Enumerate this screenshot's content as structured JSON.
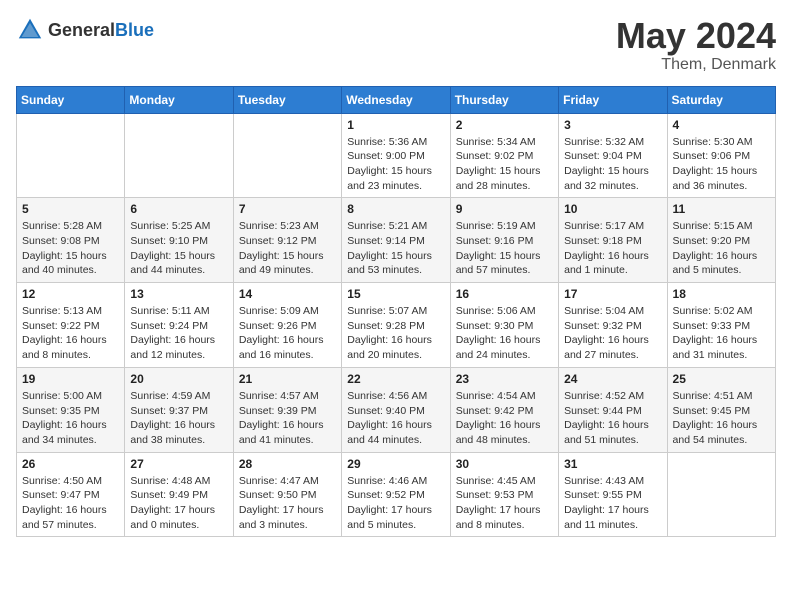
{
  "header": {
    "logo_general": "General",
    "logo_blue": "Blue",
    "month": "May 2024",
    "location": "Them, Denmark"
  },
  "weekdays": [
    "Sunday",
    "Monday",
    "Tuesday",
    "Wednesday",
    "Thursday",
    "Friday",
    "Saturday"
  ],
  "weeks": [
    [
      {
        "day": "",
        "info": ""
      },
      {
        "day": "",
        "info": ""
      },
      {
        "day": "",
        "info": ""
      },
      {
        "day": "1",
        "info": "Sunrise: 5:36 AM\nSunset: 9:00 PM\nDaylight: 15 hours\nand 23 minutes."
      },
      {
        "day": "2",
        "info": "Sunrise: 5:34 AM\nSunset: 9:02 PM\nDaylight: 15 hours\nand 28 minutes."
      },
      {
        "day": "3",
        "info": "Sunrise: 5:32 AM\nSunset: 9:04 PM\nDaylight: 15 hours\nand 32 minutes."
      },
      {
        "day": "4",
        "info": "Sunrise: 5:30 AM\nSunset: 9:06 PM\nDaylight: 15 hours\nand 36 minutes."
      }
    ],
    [
      {
        "day": "5",
        "info": "Sunrise: 5:28 AM\nSunset: 9:08 PM\nDaylight: 15 hours\nand 40 minutes."
      },
      {
        "day": "6",
        "info": "Sunrise: 5:25 AM\nSunset: 9:10 PM\nDaylight: 15 hours\nand 44 minutes."
      },
      {
        "day": "7",
        "info": "Sunrise: 5:23 AM\nSunset: 9:12 PM\nDaylight: 15 hours\nand 49 minutes."
      },
      {
        "day": "8",
        "info": "Sunrise: 5:21 AM\nSunset: 9:14 PM\nDaylight: 15 hours\nand 53 minutes."
      },
      {
        "day": "9",
        "info": "Sunrise: 5:19 AM\nSunset: 9:16 PM\nDaylight: 15 hours\nand 57 minutes."
      },
      {
        "day": "10",
        "info": "Sunrise: 5:17 AM\nSunset: 9:18 PM\nDaylight: 16 hours\nand 1 minute."
      },
      {
        "day": "11",
        "info": "Sunrise: 5:15 AM\nSunset: 9:20 PM\nDaylight: 16 hours\nand 5 minutes."
      }
    ],
    [
      {
        "day": "12",
        "info": "Sunrise: 5:13 AM\nSunset: 9:22 PM\nDaylight: 16 hours\nand 8 minutes."
      },
      {
        "day": "13",
        "info": "Sunrise: 5:11 AM\nSunset: 9:24 PM\nDaylight: 16 hours\nand 12 minutes."
      },
      {
        "day": "14",
        "info": "Sunrise: 5:09 AM\nSunset: 9:26 PM\nDaylight: 16 hours\nand 16 minutes."
      },
      {
        "day": "15",
        "info": "Sunrise: 5:07 AM\nSunset: 9:28 PM\nDaylight: 16 hours\nand 20 minutes."
      },
      {
        "day": "16",
        "info": "Sunrise: 5:06 AM\nSunset: 9:30 PM\nDaylight: 16 hours\nand 24 minutes."
      },
      {
        "day": "17",
        "info": "Sunrise: 5:04 AM\nSunset: 9:32 PM\nDaylight: 16 hours\nand 27 minutes."
      },
      {
        "day": "18",
        "info": "Sunrise: 5:02 AM\nSunset: 9:33 PM\nDaylight: 16 hours\nand 31 minutes."
      }
    ],
    [
      {
        "day": "19",
        "info": "Sunrise: 5:00 AM\nSunset: 9:35 PM\nDaylight: 16 hours\nand 34 minutes."
      },
      {
        "day": "20",
        "info": "Sunrise: 4:59 AM\nSunset: 9:37 PM\nDaylight: 16 hours\nand 38 minutes."
      },
      {
        "day": "21",
        "info": "Sunrise: 4:57 AM\nSunset: 9:39 PM\nDaylight: 16 hours\nand 41 minutes."
      },
      {
        "day": "22",
        "info": "Sunrise: 4:56 AM\nSunset: 9:40 PM\nDaylight: 16 hours\nand 44 minutes."
      },
      {
        "day": "23",
        "info": "Sunrise: 4:54 AM\nSunset: 9:42 PM\nDaylight: 16 hours\nand 48 minutes."
      },
      {
        "day": "24",
        "info": "Sunrise: 4:52 AM\nSunset: 9:44 PM\nDaylight: 16 hours\nand 51 minutes."
      },
      {
        "day": "25",
        "info": "Sunrise: 4:51 AM\nSunset: 9:45 PM\nDaylight: 16 hours\nand 54 minutes."
      }
    ],
    [
      {
        "day": "26",
        "info": "Sunrise: 4:50 AM\nSunset: 9:47 PM\nDaylight: 16 hours\nand 57 minutes."
      },
      {
        "day": "27",
        "info": "Sunrise: 4:48 AM\nSunset: 9:49 PM\nDaylight: 17 hours\nand 0 minutes."
      },
      {
        "day": "28",
        "info": "Sunrise: 4:47 AM\nSunset: 9:50 PM\nDaylight: 17 hours\nand 3 minutes."
      },
      {
        "day": "29",
        "info": "Sunrise: 4:46 AM\nSunset: 9:52 PM\nDaylight: 17 hours\nand 5 minutes."
      },
      {
        "day": "30",
        "info": "Sunrise: 4:45 AM\nSunset: 9:53 PM\nDaylight: 17 hours\nand 8 minutes."
      },
      {
        "day": "31",
        "info": "Sunrise: 4:43 AM\nSunset: 9:55 PM\nDaylight: 17 hours\nand 11 minutes."
      },
      {
        "day": "",
        "info": ""
      }
    ]
  ]
}
